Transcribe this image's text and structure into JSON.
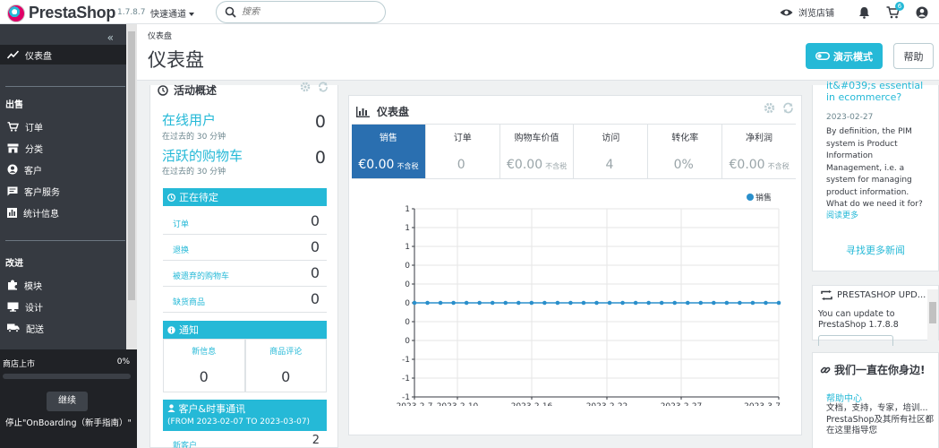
{
  "topbar": {
    "brand": "PrestaShop",
    "version": "1.7.8.7",
    "quick_access": "快速通道",
    "search_placeholder": "搜索",
    "view_shop": "浏览店铺",
    "cart_badge": "6"
  },
  "sidebar": {
    "items": [
      {
        "label": "仪表盘",
        "icon": "trend-icon"
      },
      {
        "label": "订单",
        "icon": "cart-icon"
      },
      {
        "label": "分类",
        "icon": "store-icon"
      },
      {
        "label": "客户",
        "icon": "user-icon"
      },
      {
        "label": "客户服务",
        "icon": "chat-icon"
      },
      {
        "label": "统计信息",
        "icon": "chart-icon"
      },
      {
        "label": "模块",
        "icon": "puzzle-icon"
      },
      {
        "label": "设计",
        "icon": "desktop-icon"
      },
      {
        "label": "配送",
        "icon": "truck-icon"
      }
    ],
    "sections": {
      "sell": "出售",
      "improve": "改进"
    }
  },
  "onboarding": {
    "label": "商店上市",
    "percent": "0%",
    "continue": "继续",
    "message": "停止\"OnBoarding（新手指南）\""
  },
  "header": {
    "breadcrumb": "仪表盘",
    "title": "仪表盘",
    "demo_button": "演示模式",
    "help_button": "帮助"
  },
  "activity": {
    "title": "活动概述",
    "online_label": "在线用户",
    "online_sub": "在过去的 30 分钟",
    "online_value": "0",
    "carts_label": "活跃的购物车",
    "carts_sub": "在过去的 30 分钟",
    "carts_value": "0",
    "pending_title": "正在待定",
    "pending": [
      {
        "label": "订单",
        "value": "0"
      },
      {
        "label": "退换",
        "value": "0"
      },
      {
        "label": "被遗弃的购物车",
        "value": "0"
      },
      {
        "label": "缺货商品",
        "value": "0"
      }
    ],
    "notif_title": "通知",
    "notif": [
      {
        "label": "新信息",
        "value": "0"
      },
      {
        "label": "商品评论",
        "value": "0"
      }
    ],
    "customers_title": "客户&时事通讯",
    "customers_range": "(FROM 2023-02-07 TO 2023-03-07)",
    "new_customers_label": "新客户",
    "new_customers_value": "2"
  },
  "dashboard": {
    "title": "仪表盘",
    "kpis": [
      {
        "label": "销售",
        "value": "€0.00",
        "tax": "不含税"
      },
      {
        "label": "订单",
        "value": "0",
        "tax": ""
      },
      {
        "label": "购物车价值",
        "value": "€0.00",
        "tax": "不含税"
      },
      {
        "label": "访问",
        "value": "4",
        "tax": ""
      },
      {
        "label": "转化率",
        "value": "0%",
        "tax": ""
      },
      {
        "label": "净利润",
        "value": "€0.00",
        "tax": "不含税"
      }
    ]
  },
  "chart_data": {
    "type": "line",
    "series": [
      {
        "name": "销售",
        "values": [
          0,
          0,
          0,
          0,
          0,
          0,
          0,
          0,
          0,
          0,
          0,
          0,
          0,
          0,
          0,
          0,
          0,
          0,
          0,
          0,
          0,
          0,
          0,
          0,
          0,
          0,
          0,
          0,
          0
        ]
      }
    ],
    "x_tick_labels": [
      "2023-2-7",
      "2023-2-10",
      "2023-2-16",
      "2023-2-22",
      "2023-2-27",
      "2023-3-7"
    ],
    "y_tick_labels": [
      "1",
      "1",
      "1",
      "0",
      "0",
      "0",
      "0",
      "0",
      "-1",
      "-1",
      "-1"
    ],
    "ylim": [
      -1,
      1
    ],
    "legend": "top-right",
    "grid": true,
    "color": "#2a8fcb"
  },
  "news": {
    "partial_title": "it&#039;s essential in ecommerce?",
    "date": "2023-02-27",
    "body": "By definition, the PIM system is Product Information Management, i.e. a system for managing product information. What do we need it for?",
    "read_more": "阅读更多",
    "find_more": "寻找更多新闻"
  },
  "update": {
    "title": "PRESTASHOP UPD...",
    "text": "You can update to PrestaShop 1.7.8.8"
  },
  "support": {
    "title": "我们一直在你身边!",
    "link": "帮助中心",
    "text": "文档，支持，专家，培训... PrestaShop及其所有社区都在这里指导您"
  },
  "colors": {
    "accent": "#25b9d7",
    "sidebar": "#363a41",
    "kpi_selected": "#2a6fb0"
  }
}
